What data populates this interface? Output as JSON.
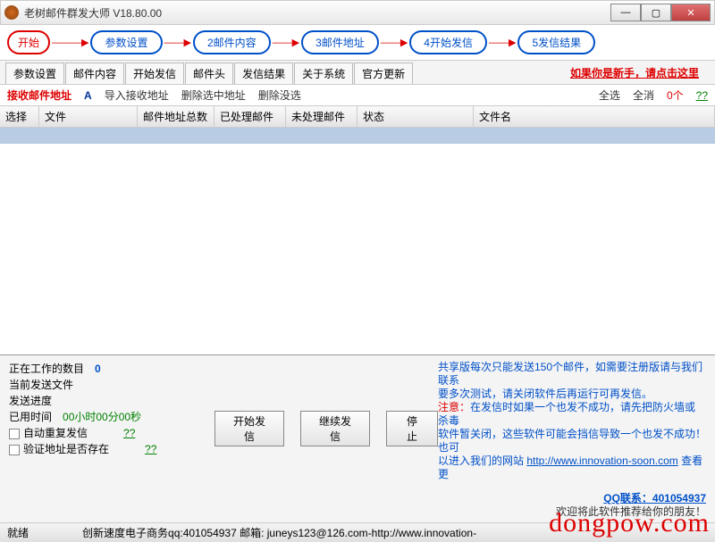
{
  "window": {
    "title": "老树邮件群发大师 V18.80.00"
  },
  "steps": {
    "start": "开始",
    "s1": "参数设置",
    "s2": "2邮件内容",
    "s3": "3邮件地址",
    "s4": "4开始发信",
    "s5": "5发信结果"
  },
  "tabs": [
    "参数设置",
    "邮件内容",
    "开始发信",
    "邮件头",
    "发信结果",
    "关于系统",
    "官方更新"
  ],
  "newbie": "如果你是新手，请点击这里",
  "toolbar": {
    "title": "接收邮件地址",
    "a": "A",
    "import": "导入接收地址",
    "delSel": "删除选中地址",
    "delUnsel": "删除没选",
    "selAll": "全选",
    "unselAll": "全消",
    "count": "0个",
    "qq": "??"
  },
  "columns": {
    "c1": "选择",
    "c2": "文件",
    "c3": "邮件地址总数",
    "c4": "已处理邮件",
    "c5": "未处理邮件",
    "c6": "状态",
    "c7": "文件名"
  },
  "status": {
    "working": "正在工作的数目",
    "workingVal": "0",
    "curFile": "当前发送文件",
    "progress": "发送进度",
    "elapsed": "已用时间",
    "elapsedVal": "00小时00分00秒",
    "autoResend": "自动重复发信",
    "autoResendQ": "??",
    "verify": "验证地址是否存在",
    "verifyQ": "??"
  },
  "buttons": {
    "start": "开始发信",
    "continue": "继续发信",
    "stop": "停止"
  },
  "notice": {
    "l1": "共享版每次只能发送150个邮件，如需要注册版请与我们联系",
    "l2": "要多次测试，请关闭软件后再运行可再发信。",
    "l3a": "注意：",
    "l3b": "在发信时如果一个也发不成功，请先把防火墙或杀毒",
    "l4": "软件暂关闭，这些软件可能会挡信导致一个也发不成功！也可",
    "l5a": "以进入我们的网站 ",
    "l5b": "http://www.innovation-soon.com",
    "l5c": " 查看更",
    "qq": "QQ联系：401054937",
    "welcome": "欢迎将此软件推荐给你的朋友！"
  },
  "statusbar": {
    "ready": "就绪",
    "info": "创新速度电子商务qq:401054937 邮箱: juneys123@126.com-http://www.innovation-"
  },
  "watermark": "dongpow.com"
}
